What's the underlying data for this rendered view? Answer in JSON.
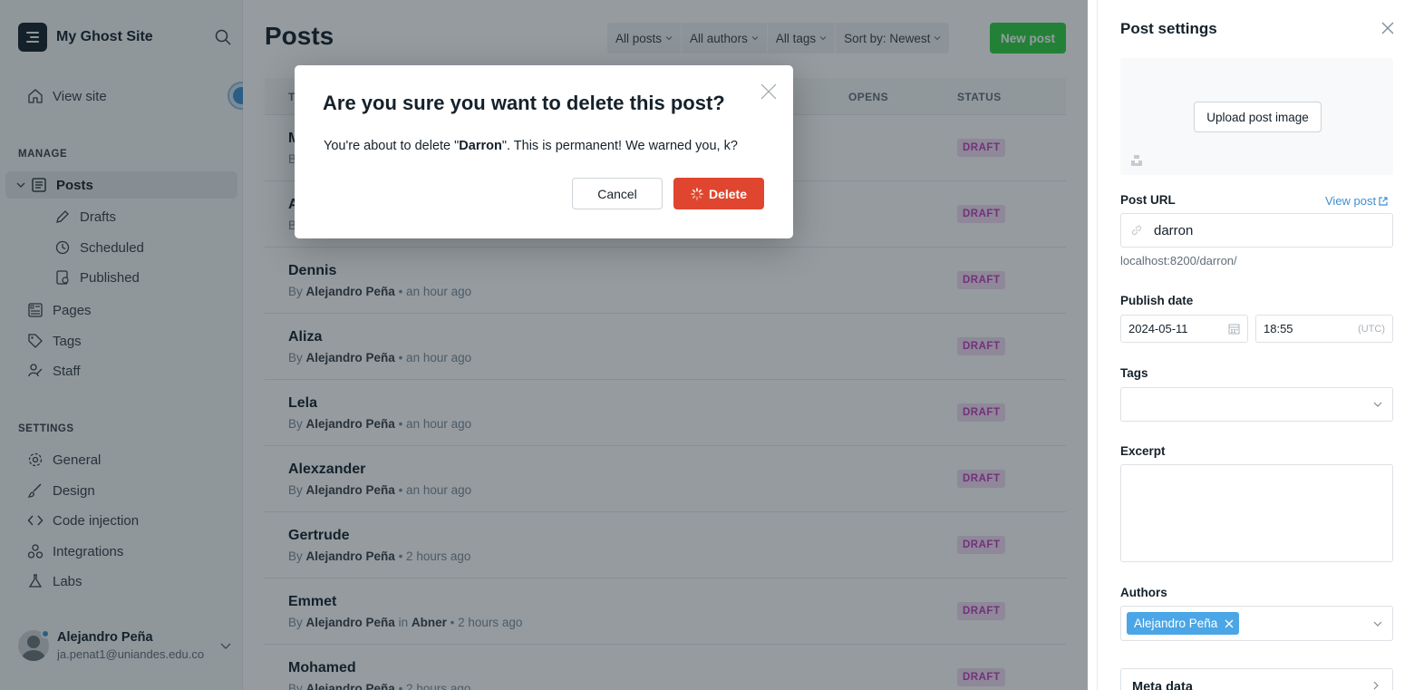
{
  "sidebar": {
    "site_title": "My Ghost Site",
    "view_site": "View site",
    "manage_heading": "MANAGE",
    "posts": "Posts",
    "drafts": "Drafts",
    "scheduled": "Scheduled",
    "published": "Published",
    "pages": "Pages",
    "tags": "Tags",
    "staff": "Staff",
    "settings_heading": "SETTINGS",
    "general": "General",
    "design": "Design",
    "code_injection": "Code injection",
    "integrations": "Integrations",
    "labs": "Labs",
    "user_name": "Alejandro Peña",
    "user_email": "ja.penat1@uniandes.edu.co"
  },
  "main": {
    "title": "Posts",
    "filters": [
      "All posts",
      "All authors",
      "All tags",
      "Sort by: Newest"
    ],
    "new_post": "New post",
    "columns": {
      "title": "T",
      "opens": "OPENS",
      "status": "STATUS"
    },
    "rows": [
      {
        "title": "M",
        "meta_by": "B",
        "meta_author": "",
        "meta_tail": "",
        "status": "DRAFT"
      },
      {
        "title": "A",
        "meta_by": "B",
        "meta_author": "",
        "meta_tail": "",
        "status": "DRAFT"
      },
      {
        "title": "Dennis",
        "meta_by": "By",
        "meta_author": "Alejandro Peña",
        "meta_tail": "• an hour ago",
        "status": "DRAFT"
      },
      {
        "title": "Aliza",
        "meta_by": "By",
        "meta_author": "Alejandro Peña",
        "meta_tail": "• an hour ago",
        "status": "DRAFT"
      },
      {
        "title": "Lela",
        "meta_by": "By",
        "meta_author": "Alejandro Peña",
        "meta_tail": "• an hour ago",
        "status": "DRAFT"
      },
      {
        "title": "Alexzander",
        "meta_by": "By",
        "meta_author": "Alejandro Peña",
        "meta_tail": "• an hour ago",
        "status": "DRAFT"
      },
      {
        "title": "Gertrude",
        "meta_by": "By",
        "meta_author": "Alejandro Peña",
        "meta_tail": "• 2 hours ago",
        "status": "DRAFT"
      },
      {
        "title": "Emmet",
        "meta_by": "By",
        "meta_author": "Alejandro Peña",
        "meta_in": "in",
        "meta_tag": "Abner",
        "meta_tail": "• 2 hours ago",
        "status": "DRAFT"
      },
      {
        "title": "Mohamed",
        "meta_by": "By",
        "meta_author": "Alejandro Peña",
        "meta_tail": "• 2 hours ago",
        "status": "DRAFT"
      }
    ]
  },
  "modal": {
    "title": "Are you sure you want to delete this post?",
    "body_prefix": "You're about to delete \"",
    "body_post": "Darron",
    "body_suffix": "\". This is permanent! We warned you, k?",
    "cancel": "Cancel",
    "delete": "Delete"
  },
  "panel": {
    "title": "Post settings",
    "upload_image": "Upload post image",
    "post_url_label": "Post URL",
    "view_post": "View post",
    "slug": "darron",
    "url_hint": "localhost:8200/darron/",
    "publish_date_label": "Publish date",
    "date": "2024-05-11",
    "time": "18:55",
    "timezone": "(UTC)",
    "tags_label": "Tags",
    "excerpt_label": "Excerpt",
    "authors_label": "Authors",
    "author_chip": "Alejandro Peña",
    "meta_data": "Meta data"
  },
  "colors": {
    "primary_green": "#30cf43",
    "delete_red": "#e0462f",
    "draft_badge_bg": "#f2ddf3",
    "draft_badge_text": "#c03fbd",
    "link_blue": "#3f8fd0"
  }
}
